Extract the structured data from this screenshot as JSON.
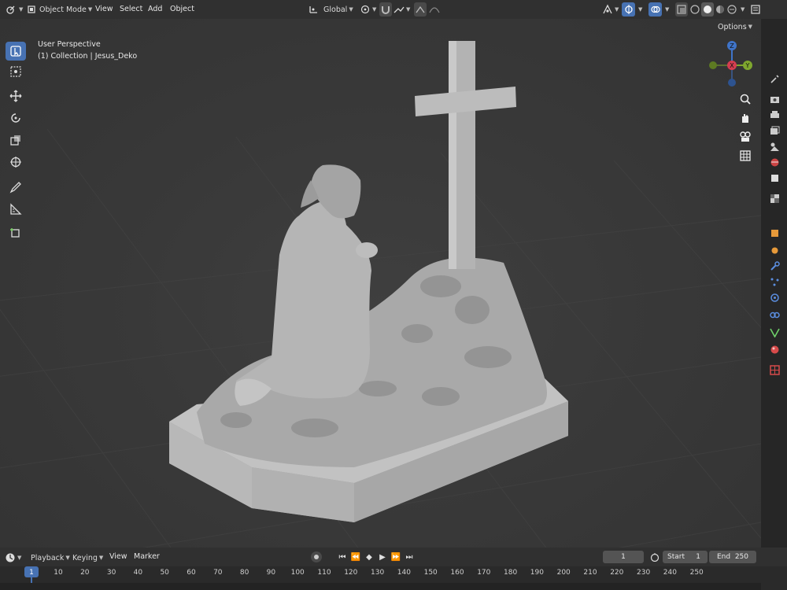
{
  "header": {
    "mode": "Object Mode",
    "menus": [
      "View",
      "Select",
      "Add",
      "Object"
    ],
    "orientation": "Global"
  },
  "viewport": {
    "view_name": "User Perspective",
    "collection": "(1) Collection | Jesus_Deko",
    "options_label": "Options",
    "gizmo": {
      "x": "X",
      "y": "Y",
      "z": "Z"
    }
  },
  "timeline": {
    "menus": [
      "Playback",
      "Keying",
      "View",
      "Marker"
    ],
    "current_frame": "1",
    "start_label": "Start",
    "start_value": "1",
    "end_label": "End",
    "end_value": "250",
    "ruler": [
      "1",
      "10",
      "20",
      "30",
      "40",
      "50",
      "60",
      "70",
      "80",
      "90",
      "100",
      "110",
      "120",
      "130",
      "140",
      "150",
      "160",
      "170",
      "180",
      "190",
      "200",
      "210",
      "220",
      "230",
      "240",
      "250"
    ]
  },
  "colors": {
    "accent": "#4772b3",
    "header_bg": "#303030",
    "viewport_bg": "#393939",
    "axis_x": "#d43d50",
    "axis_y": "#7fa72e",
    "axis_z": "#3f74c9"
  }
}
